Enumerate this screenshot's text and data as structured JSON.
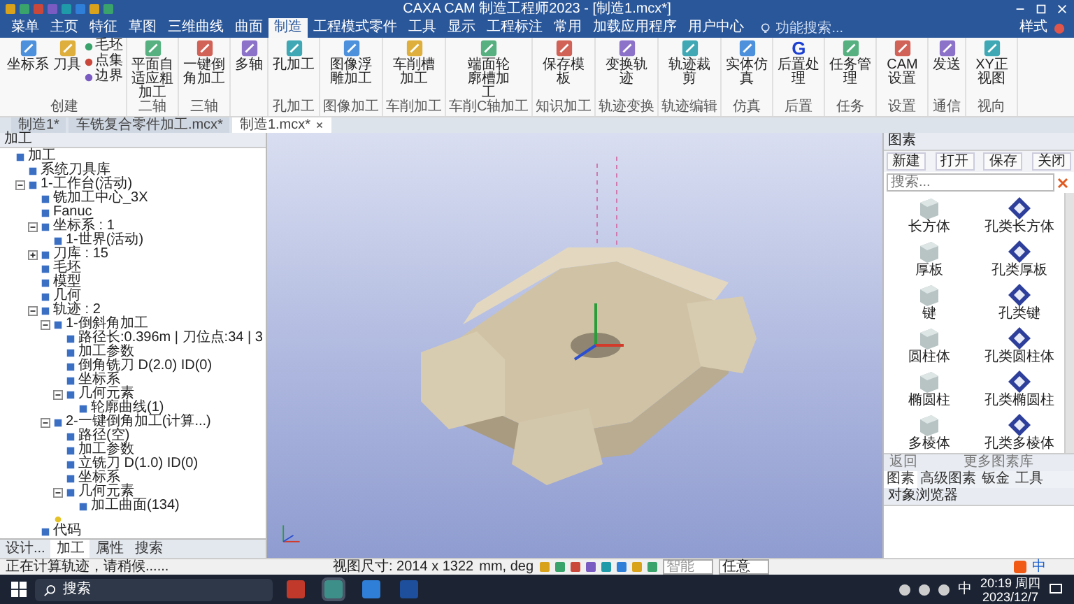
{
  "title_bar": {
    "title": "CAXA CAM 制造工程师2023 - [制造1.mcx*]"
  },
  "menu_tabs": [
    {
      "label": "菜单",
      "selected": false
    },
    {
      "label": "主页",
      "selected": false
    },
    {
      "label": "特征",
      "selected": false
    },
    {
      "label": "草图",
      "selected": false
    },
    {
      "label": "三维曲线",
      "selected": false
    },
    {
      "label": "曲面",
      "selected": false
    },
    {
      "label": "制造",
      "selected": true
    },
    {
      "label": "工程模式零件",
      "selected": false
    },
    {
      "label": "工具",
      "selected": false
    },
    {
      "label": "显示",
      "selected": false
    },
    {
      "label": "工程标注",
      "selected": false
    },
    {
      "label": "常用",
      "selected": false
    },
    {
      "label": "加载应用程序",
      "selected": false
    },
    {
      "label": "用户中心",
      "selected": false
    }
  ],
  "menu_search": {
    "placeholder": "功能搜索..."
  },
  "style_menu": "样式",
  "ribbon": {
    "groups": [
      {
        "label": "创建",
        "buttons": [
          "坐标系",
          "刀具"
        ],
        "small_buttons": [
          "毛坯",
          "点集",
          "边界"
        ]
      },
      {
        "label": "二轴",
        "buttons": [
          "平面自适应粗加工"
        ]
      },
      {
        "label": "三轴",
        "buttons": [
          "一键倒角加工"
        ]
      },
      {
        "buttons": [
          "多轴"
        ]
      },
      {
        "label": "孔加工",
        "buttons": [
          "孔加工"
        ]
      },
      {
        "label": "图像加工",
        "buttons": [
          "图像浮雕加工"
        ]
      },
      {
        "label": "车削加工",
        "buttons": [
          "车削槽加工"
        ]
      },
      {
        "label": "车削C轴加工",
        "buttons": [
          "端面轮廓槽加工"
        ]
      },
      {
        "label": "知识加工",
        "buttons": [
          "保存模板"
        ]
      },
      {
        "label": "轨迹变换",
        "buttons": [
          "变换轨迹"
        ]
      },
      {
        "label": "轨迹编辑",
        "buttons": [
          "轨迹裁剪"
        ]
      },
      {
        "label": "仿真",
        "buttons": [
          "实体仿真"
        ]
      },
      {
        "label": "后置",
        "buttons": [
          "后置处理"
        ],
        "glyph": "G"
      },
      {
        "label": "任务",
        "buttons": [
          "任务管理"
        ]
      },
      {
        "label": "设置",
        "buttons": [
          "CAM设置"
        ]
      },
      {
        "label": "通信",
        "buttons": [
          "发送"
        ]
      },
      {
        "label": "视向",
        "buttons": [
          "XY正视图"
        ]
      }
    ]
  },
  "doc_tabs": [
    {
      "label": "制造1*",
      "selected": false
    },
    {
      "label": "车铣复合零件加工.mcx*",
      "selected": false
    },
    {
      "label": "制造1.mcx*",
      "selected": true
    }
  ],
  "left_panel": {
    "title": "加工",
    "tree": [
      {
        "label": "加工",
        "children": [
          {
            "label": "系统刀具库"
          },
          {
            "label": "1-工作台(活动)",
            "expanded": true,
            "children": [
              {
                "label": "铣加工中心_3X"
              },
              {
                "label": "Fanuc"
              },
              {
                "label": "坐标系 : 1",
                "expanded": true,
                "children": [
                  {
                    "label": "1-世界(活动)"
                  }
                ]
              },
              {
                "label": "刀库 : 15",
                "expanded": false
              },
              {
                "label": "毛坯"
              },
              {
                "label": "模型"
              },
              {
                "label": "几何"
              },
              {
                "label": "轨迹 : 2",
                "expanded": true,
                "children": [
                  {
                    "label": "1-倒斜角加工",
                    "expanded": true,
                    "children": [
                      {
                        "label": "路径长:0.396m | 刀位点:34 | 3"
                      },
                      {
                        "label": "加工参数"
                      },
                      {
                        "label": "倒角铣刀 D(2.0) ID(0)"
                      },
                      {
                        "label": "坐标系"
                      },
                      {
                        "label": "几何元素",
                        "expanded": true,
                        "children": [
                          {
                            "label": "轮廓曲线(1)"
                          }
                        ]
                      }
                    ]
                  },
                  {
                    "label": "2-一键倒角加工(计算...)",
                    "expanded": true,
                    "children": [
                      {
                        "label": "路径(空)"
                      },
                      {
                        "label": "加工参数"
                      },
                      {
                        "label": "立铣刀 D(1.0) ID(0)"
                      },
                      {
                        "label": "坐标系"
                      },
                      {
                        "label": "几何元素",
                        "expanded": true,
                        "children": [
                          {
                            "label": "加工曲面(134)"
                          }
                        ]
                      }
                    ]
                  },
                  {
                    "kind": "pending"
                  }
                ]
              },
              {
                "label": "代码"
              }
            ]
          }
        ]
      }
    ],
    "bottom_tabs": [
      {
        "label": "设计...",
        "selected": false
      },
      {
        "label": "加工",
        "selected": true
      },
      {
        "label": "属性",
        "selected": false
      },
      {
        "label": "搜索",
        "selected": false
      }
    ]
  },
  "right_panel": {
    "title": "图素",
    "buttons": [
      "新建",
      "打开",
      "保存",
      "关闭"
    ],
    "search": {
      "placeholder": "搜索..."
    },
    "items": [
      {
        "label": "长方体",
        "kind": "solid"
      },
      {
        "label": "孔类长方体",
        "kind": "hole"
      },
      {
        "label": "厚板",
        "kind": "solid"
      },
      {
        "label": "孔类厚板",
        "kind": "hole"
      },
      {
        "label": "键",
        "kind": "solid"
      },
      {
        "label": "孔类键",
        "kind": "hole"
      },
      {
        "label": "圆柱体",
        "kind": "solid"
      },
      {
        "label": "孔类圆柱体",
        "kind": "hole"
      },
      {
        "label": "椭圆柱",
        "kind": "solid"
      },
      {
        "label": "孔类椭圆柱",
        "kind": "hole"
      },
      {
        "label": "多棱体",
        "kind": "solid"
      },
      {
        "label": "孔类多棱体",
        "kind": "hole"
      }
    ],
    "back": "返回",
    "library": "更多图素库",
    "tabs": [
      {
        "label": "图素",
        "selected": true
      },
      {
        "label": "高级图素",
        "selected": false
      },
      {
        "label": "钣金",
        "selected": false
      },
      {
        "label": "工具",
        "selected": false
      }
    ],
    "browser_title": "对象浏览器"
  },
  "status_bar": {
    "message": "正在计算轨迹，请稍候......",
    "view_size": "视图尺寸: 2014 x 1322",
    "units": "mm, deg",
    "snap_mode": "智能",
    "pick_mode": "任意",
    "ime": "中"
  },
  "taskbar": {
    "search": {
      "placeholder": "搜索"
    },
    "ime": "中",
    "time": "20:19 周四",
    "date": "2023/12/7"
  }
}
